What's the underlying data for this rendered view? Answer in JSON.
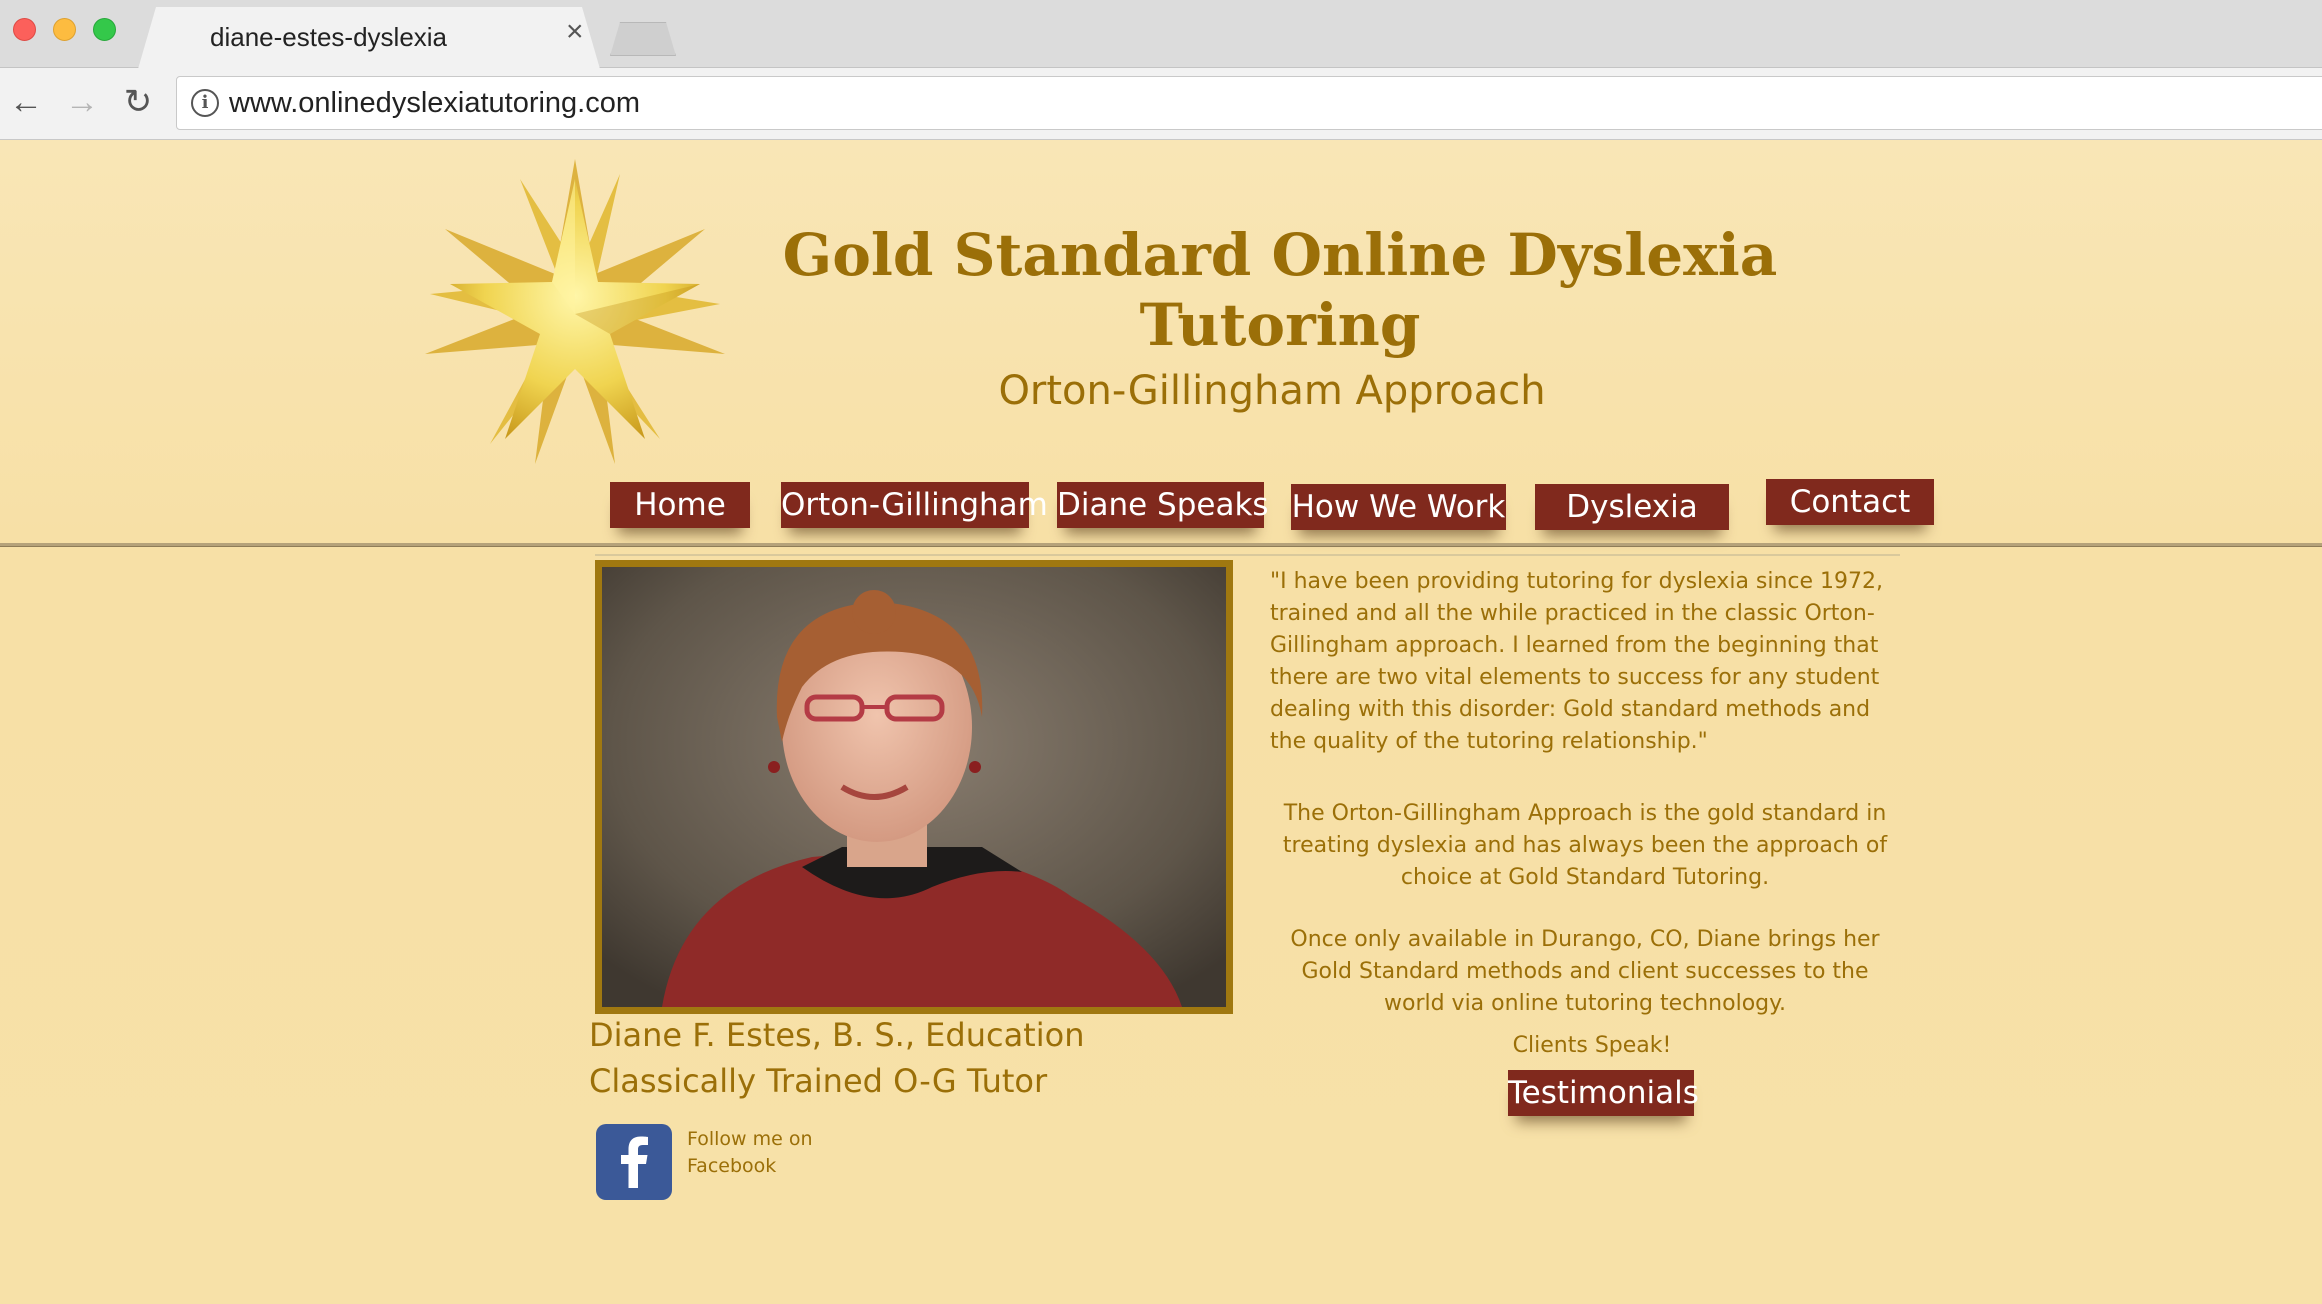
{
  "browser": {
    "tab_title": "diane-estes-dyslexia",
    "url": "www.onlinedyslexiatutoring.com"
  },
  "header": {
    "title": "Gold Standard Online Dyslexia Tutoring",
    "subtitle": "Orton-Gillingham Approach"
  },
  "nav": {
    "items": [
      "Home",
      "Orton-Gillingham",
      "Diane Speaks",
      "How We Work",
      "Dyslexia",
      "Contact"
    ]
  },
  "profile": {
    "name_line": "Diane F. Estes, B. S., Education",
    "credential_line": "Classically Trained O-G Tutor",
    "facebook_text": "Follow me on Facebook"
  },
  "content": {
    "quote": "\"I have been providing tutoring for dyslexia since 1972, trained and all the while practiced in the classic Orton-Gillingham approach. I learned from the beginning that there are two vital elements to success for any student dealing with this disorder:  Gold standard methods and the quality of the tutoring relationship.\"",
    "paragraph1": "The Orton-Gillingham Approach is the gold standard in treating dyslexia and has always been the approach of choice at Gold Standard Tutoring.",
    "paragraph2": "Once only available in Durango, CO, Diane brings her Gold Standard methods and client successes to the world via online tutoring technology.",
    "clients_label": "Clients Speak!",
    "testimonials_button": "Testimonials"
  },
  "colors": {
    "accent_gold": "#9b6f08",
    "button_maroon": "#80291d",
    "page_background": "#f8e4ad",
    "facebook_blue": "#3b5998"
  }
}
